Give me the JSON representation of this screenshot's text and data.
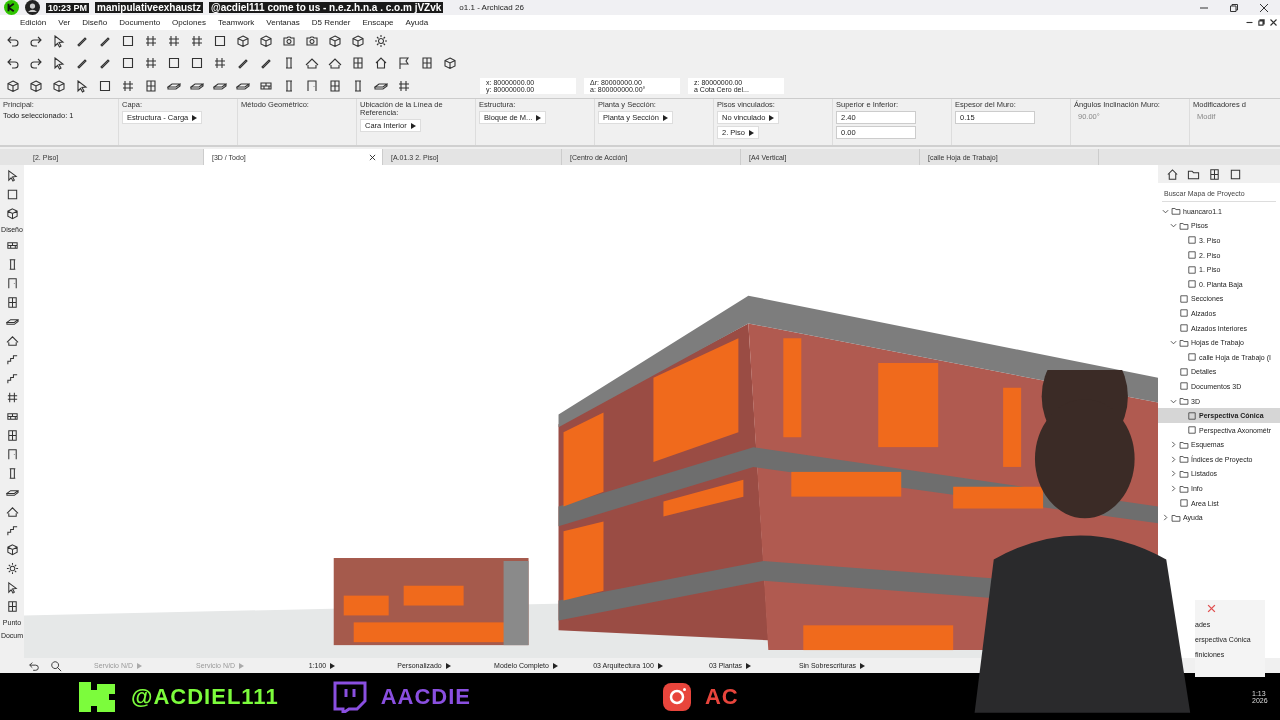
{
  "window": {
    "title": "o1.1 - Archicad 26"
  },
  "notification": {
    "time": "10:23 PM",
    "user": "manipulativeexhaustz",
    "message": "@acdiel111 come to us - n.e.z.h.n.a . c.o.m jVZvk"
  },
  "menu": [
    "Edición",
    "Ver",
    "Diseño",
    "Documento",
    "Opciones",
    "Teamwork",
    "Ventanas",
    "D5 Render",
    "Enscape",
    "Ayuda"
  ],
  "coordinates": [
    {
      "label": "x:",
      "value": "80000000.00"
    },
    {
      "label": "y:",
      "value": "80000000.00"
    },
    {
      "label": "Δr:",
      "value": "80000000.00"
    },
    {
      "label": "a:",
      "value": "800000000.00°"
    },
    {
      "label": "z:",
      "value": "80000000.00"
    }
  ],
  "z_reference": "a Cota Cero del...",
  "info_box": [
    {
      "label": "Principal:",
      "note": "Todo seleccionado: 1"
    },
    {
      "label": "Capa:",
      "controls": [
        {
          "kind": "select",
          "value": "Estructura - Carga"
        }
      ]
    },
    {
      "label": "Método Geométrico:"
    },
    {
      "label": "Ubicación de la Línea de Referencia:",
      "controls": [
        {
          "kind": "select",
          "value": "Cara Interior"
        }
      ]
    },
    {
      "label": "Estructura:",
      "controls": [
        {
          "kind": "select",
          "value": "Bloque de M..."
        }
      ]
    },
    {
      "label": "Planta y Sección:",
      "controls": [
        {
          "kind": "select",
          "value": "Planta y Sección"
        }
      ]
    },
    {
      "label": "Pisos vinculados:",
      "controls": [
        {
          "kind": "select",
          "value": "No vinculado"
        },
        {
          "kind": "select",
          "value": "2. Piso"
        }
      ]
    },
    {
      "label": "Superior e Inferior:",
      "controls": [
        {
          "kind": "input",
          "value": "2.40"
        },
        {
          "kind": "input",
          "value": "0.00"
        }
      ]
    },
    {
      "label": "Espesor del Muro:",
      "controls": [
        {
          "kind": "input",
          "value": "0.15"
        }
      ]
    },
    {
      "label": "Ángulos Inclinación Muro:",
      "controls": [
        {
          "kind": "text",
          "value": "90.00°"
        }
      ]
    },
    {
      "label": "Modificadores d",
      "controls": [
        {
          "kind": "text",
          "value": "Modif"
        }
      ]
    }
  ],
  "tabs": [
    {
      "label": "[2. Piso]",
      "selected": false
    },
    {
      "label": "[3D / Todo]",
      "selected": true
    },
    {
      "label": "[A.01.3 2. Piso]",
      "selected": false
    },
    {
      "label": "[Centro de Acción]",
      "selected": false
    },
    {
      "label": "[A4 Vertical]",
      "selected": false
    },
    {
      "label": "[calle Hoja de Trabajo]",
      "selected": false
    }
  ],
  "toolbox_labels": [
    "Diseño",
    "Punto",
    "Docum"
  ],
  "navigator": {
    "search_placeholder": "Buscar Mapa de Proyecto",
    "tree": [
      {
        "label": "huancaro1.1",
        "expanded": true,
        "selected": false,
        "children": [
          {
            "label": "Pisos",
            "expanded": true,
            "selected": false,
            "children": [
              {
                "label": "3. Piso",
                "selected": false
              },
              {
                "label": "2. Piso",
                "selected": false
              },
              {
                "label": "1. Piso",
                "selected": false
              },
              {
                "label": "0. Planta Baja",
                "selected": false
              }
            ]
          },
          {
            "label": "Secciones",
            "selected": false
          },
          {
            "label": "Alzados",
            "selected": false
          },
          {
            "label": "Alzados Interiores",
            "selected": false
          },
          {
            "label": "Hojas de Trabajo",
            "expanded": true,
            "selected": false,
            "children": [
              {
                "label": "calle Hoja de Trabajo (I",
                "selected": false
              }
            ]
          },
          {
            "label": "Detalles",
            "selected": false
          },
          {
            "label": "Documentos 3D",
            "selected": false
          },
          {
            "label": "3D",
            "expanded": true,
            "selected": false,
            "children": [
              {
                "label": "Perspectiva Cónica",
                "selected": true
              },
              {
                "label": "Perspectiva Axonométr",
                "selected": false
              }
            ]
          },
          {
            "label": "Esquemas",
            "expanded": false,
            "selected": false
          },
          {
            "label": "Índices de Proyecto",
            "expanded": false,
            "selected": false
          },
          {
            "label": "Listados",
            "expanded": false,
            "selected": false
          },
          {
            "label": "Info",
            "expanded": false,
            "selected": false
          },
          {
            "label": "Area List",
            "selected": false
          }
        ]
      },
      {
        "label": "Ayuda",
        "expanded": false,
        "selected": false
      }
    ]
  },
  "side_panel": [
    "ades",
    "erspectiva Cónica",
    "finiciones"
  ],
  "clock": [
    "1:13",
    "2026"
  ],
  "status_bar": [
    {
      "text": "Servicio N/D",
      "disabled": true
    },
    {
      "text": "Servicio N/D",
      "disabled": true
    },
    {
      "text": "1:100",
      "disabled": false
    },
    {
      "text": "Personalizado",
      "disabled": false
    },
    {
      "text": "Modelo Completo",
      "disabled": false
    },
    {
      "text": "03 Arquitectura 100",
      "disabled": false
    },
    {
      "text": "03 Plantas",
      "disabled": false
    },
    {
      "text": "Sin Sobrescrituras",
      "disabled": false
    }
  ],
  "banner": [
    {
      "kind": "kick",
      "handle": "@ACDIEL111",
      "color": "#7cfc3c"
    },
    {
      "kind": "twitch",
      "handle": "AACDIE",
      "color": "#8a4fe0"
    },
    {
      "kind": "instagram",
      "handle": "AC",
      "color": "#e8453c"
    }
  ]
}
